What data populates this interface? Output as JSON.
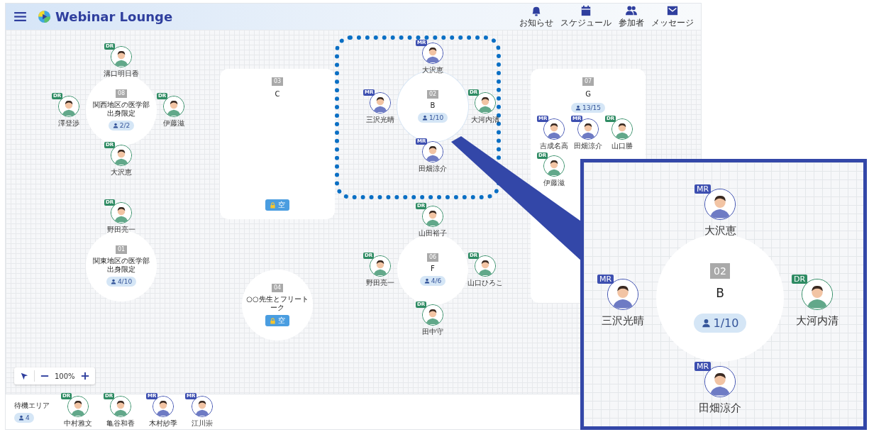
{
  "header": {
    "title": "Webinar Lounge",
    "nav": [
      {
        "kind": "bell",
        "label": "お知らせ"
      },
      {
        "kind": "calendar",
        "label": "スケジュール"
      },
      {
        "kind": "people",
        "label": "参加者"
      },
      {
        "kind": "mail",
        "label": "メッセージ"
      }
    ]
  },
  "rooms": [
    {
      "number": "08",
      "name": "関西地区の医学部出身限定",
      "kind": "circle",
      "selected": false,
      "status": {
        "kind": "count",
        "text": "2/2"
      },
      "members": [
        {
          "name": "溝口明日香",
          "role": "DR",
          "color": "#2e8b63"
        },
        {
          "name": "澤登渉",
          "role": "DR",
          "color": "#2e8b63"
        },
        {
          "name": "伊藤滋",
          "role": "DR",
          "color": "#2e8b63"
        },
        {
          "name": "大沢恵",
          "role": "DR",
          "color": "#2e8b63"
        }
      ]
    },
    {
      "number": "03",
      "name": "C",
      "kind": "card",
      "selected": false,
      "status": {
        "kind": "locked",
        "text": "空"
      }
    },
    {
      "number": "02",
      "name": "B",
      "kind": "circle",
      "selected": true,
      "status": {
        "kind": "count",
        "text": "1/10"
      },
      "members": [
        {
          "name": "大沢恵",
          "role": "MR",
          "color": "#3d4fb0"
        },
        {
          "name": "三沢光晴",
          "role": "MR",
          "color": "#3d4fb0"
        },
        {
          "name": "大河内清",
          "role": "DR",
          "color": "#2e8b63"
        },
        {
          "name": "田畑涼介",
          "role": "MR",
          "color": "#3d4fb0"
        }
      ]
    },
    {
      "number": "07",
      "name": "G",
      "kind": "card",
      "selected": false,
      "status": {
        "kind": "count",
        "text": "13/15"
      },
      "members": [
        {
          "name": "吉成名高",
          "role": "MR",
          "color": "#3d4fb0"
        },
        {
          "name": "田畑涼介",
          "role": "MR",
          "color": "#3d4fb0"
        },
        {
          "name": "山口勝",
          "role": "DR",
          "color": "#2e8b63"
        },
        {
          "name": "伊藤滋",
          "role": "DR",
          "color": "#2e8b63"
        }
      ]
    },
    {
      "number": "01",
      "name": "関東地区の医学部出身限定",
      "kind": "circle",
      "selected": false,
      "status": {
        "kind": "count",
        "text": "4/10"
      },
      "members": [
        {
          "name": "野田亮一",
          "role": "DR",
          "color": "#2e8b63"
        }
      ]
    },
    {
      "number": "06",
      "name": "F",
      "kind": "circle",
      "selected": false,
      "status": {
        "kind": "count",
        "text": "4/6"
      },
      "members": [
        {
          "name": "山田裕子",
          "role": "DR",
          "color": "#2e8b63"
        },
        {
          "name": "野田亮一",
          "role": "DR",
          "color": "#2e8b63"
        },
        {
          "name": "山口ひろこ",
          "role": "DR",
          "color": "#2e8b63"
        },
        {
          "name": "田中守",
          "role": "DR",
          "color": "#2e8b63"
        }
      ]
    },
    {
      "number": "04",
      "name": "○○先生とフリートーク",
      "kind": "circle",
      "selected": false,
      "status": {
        "kind": "locked",
        "text": "空"
      }
    }
  ],
  "zoom": {
    "value": "100%"
  },
  "waiting_area": {
    "label": "待機エリア",
    "count": "4",
    "members": [
      {
        "name": "中村雅文",
        "role": "DR",
        "color": "#2e8b63"
      },
      {
        "name": "亀谷和香",
        "role": "DR",
        "color": "#2e8b63"
      },
      {
        "name": "木村紗季",
        "role": "MR",
        "color": "#3d4fb0"
      },
      {
        "name": "江川崇",
        "role": "MR",
        "color": "#3d4fb0"
      }
    ]
  },
  "callout": {
    "number": "02",
    "name": "B",
    "status": {
      "kind": "count",
      "text": "1/10"
    },
    "members": [
      {
        "name": "大沢恵",
        "role": "MR",
        "color": "#3d4fb0"
      },
      {
        "name": "三沢光晴",
        "role": "MR",
        "color": "#3d4fb0"
      },
      {
        "name": "大河内清",
        "role": "DR",
        "color": "#2e8b63"
      },
      {
        "name": "田畑涼介",
        "role": "MR",
        "color": "#3d4fb0"
      }
    ]
  }
}
